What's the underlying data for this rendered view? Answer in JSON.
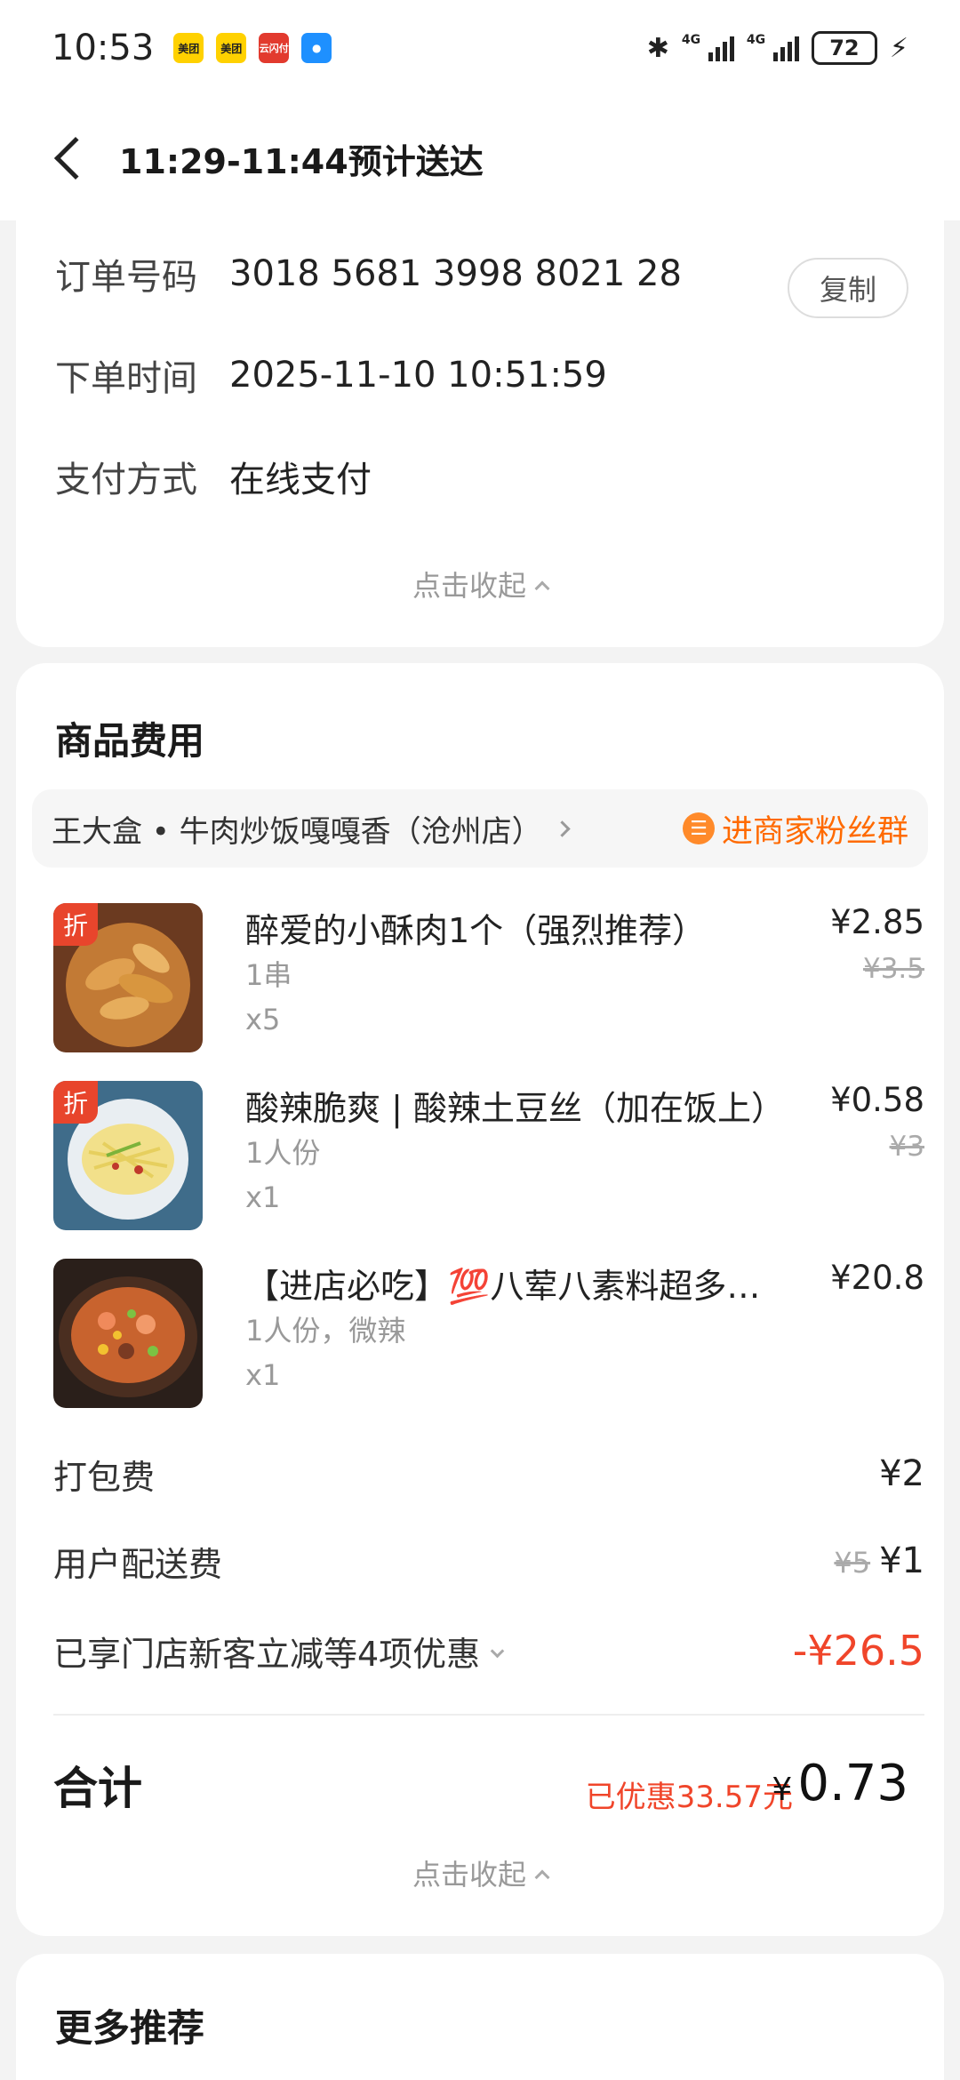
{
  "status_bar": {
    "time": "10:53",
    "battery": "72",
    "apps": [
      "美团",
      "美团",
      "云闪付",
      "message"
    ]
  },
  "header": {
    "title": "11:29-11:44预计送达"
  },
  "order_info": {
    "order_no_label": "订单号码",
    "order_no": "3018 5681 3998 8021 28",
    "copy_label": "复制",
    "time_label": "下单时间",
    "time": "2025-11-10 10:51:59",
    "pay_label": "支付方式",
    "pay": "在线支付",
    "collapse_label": "点击收起"
  },
  "fees": {
    "title": "商品费用",
    "shop_name": "王大盒 • 牛肉炒饭嘎嘎香（沧州店）",
    "fans_label": "进商家粉丝群",
    "items": [
      {
        "name": "醉爱的小酥肉1个（强烈推荐）",
        "spec": "1串",
        "qty": "x5",
        "price": "¥2.85",
        "orig": "¥3.5",
        "badge": "折"
      },
      {
        "name": "酸辣脆爽 | 酸辣土豆丝（加在饭上）",
        "spec": "1人份",
        "qty": "x1",
        "price": "¥0.58",
        "orig": "¥3",
        "badge": "折"
      },
      {
        "name": "【进店必吃】💯八荤八素料超多…",
        "spec": "1人份，微辣",
        "qty": "x1",
        "price": "¥20.8",
        "orig": ""
      }
    ],
    "packing_label": "打包费",
    "packing": "¥2",
    "delivery_label": "用户配送费",
    "delivery_orig": "¥5",
    "delivery": "¥1",
    "discount_label": "已享门店新客立减等4项优惠",
    "discount": "-¥26.5",
    "total_label": "合计",
    "saved": "已优惠33.57元",
    "total_currency": "¥",
    "total": "0.73",
    "collapse_label": "点击收起"
  },
  "more": {
    "title": "更多推荐"
  }
}
